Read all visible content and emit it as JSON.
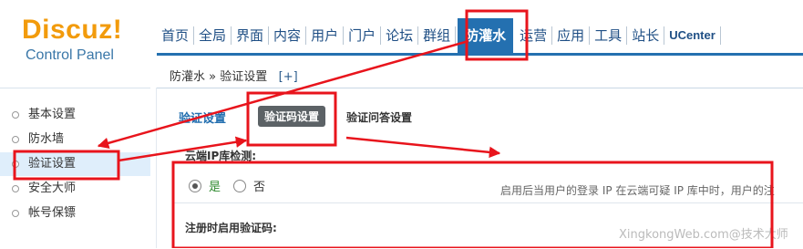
{
  "logo": {
    "brand": "Discuz!",
    "sub": "Control Panel"
  },
  "nav": [
    {
      "label": "首页"
    },
    {
      "label": "全局"
    },
    {
      "label": "界面"
    },
    {
      "label": "内容"
    },
    {
      "label": "用户"
    },
    {
      "label": "门户"
    },
    {
      "label": "论坛"
    },
    {
      "label": "群组"
    },
    {
      "label": "防灌水",
      "active": true
    },
    {
      "label": "运营"
    },
    {
      "label": "应用"
    },
    {
      "label": "工具"
    },
    {
      "label": "站长"
    },
    {
      "label": "UCenter"
    }
  ],
  "breadcrumb": {
    "text": "防灌水 » 验证设置",
    "add": "[+]"
  },
  "sidebar": [
    {
      "label": "基本设置"
    },
    {
      "label": "防水墙"
    },
    {
      "label": "验证设置",
      "active": true
    },
    {
      "label": "安全大师"
    },
    {
      "label": "帐号保镖"
    }
  ],
  "tabs": {
    "t1": "验证设置",
    "t2": "验证码设置",
    "t3": "验证问答设置"
  },
  "content": {
    "cloud_label": "云端IP库检测:",
    "yes": "是",
    "no": "否",
    "hint": "启用后当用户的登录 IP 在云端可疑 IP 库中时，用户的注",
    "reg_label": "注册时启用验证码:"
  },
  "watermark": "XingkongWeb.com@技术大师",
  "colors": {
    "annotation": "#e8141c",
    "accent": "#2470b0",
    "logo": "#f29b0c"
  }
}
